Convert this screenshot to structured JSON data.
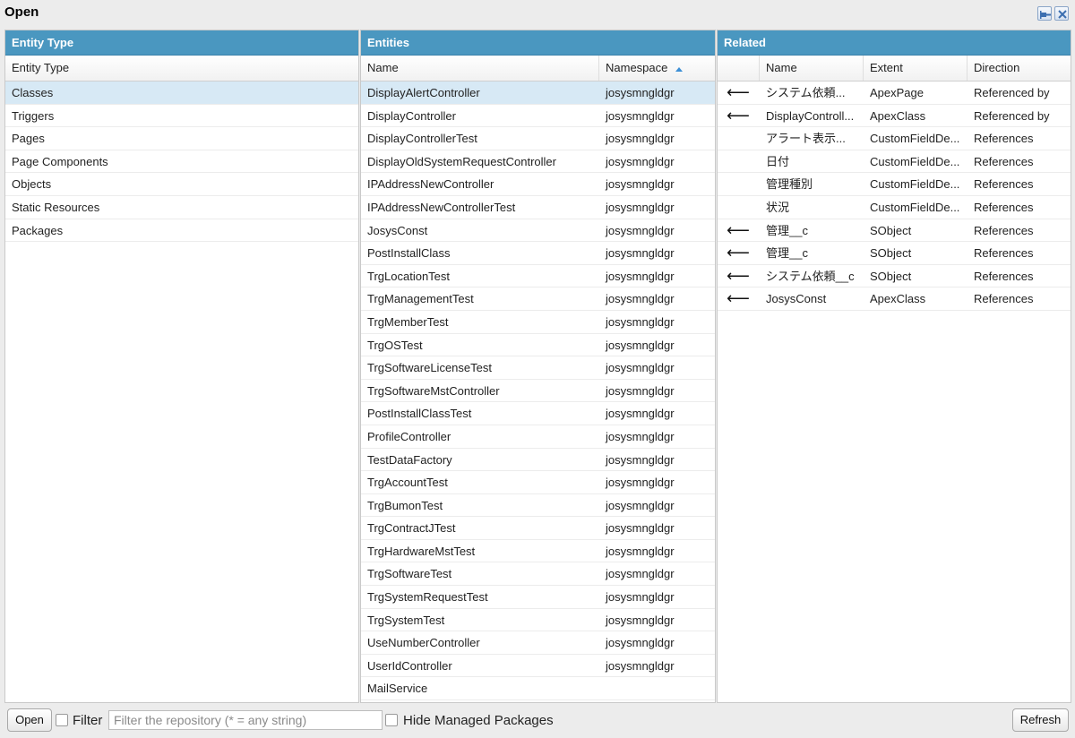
{
  "window": {
    "title": "Open"
  },
  "entity_type_panel": {
    "header": "Entity Type",
    "column": "Entity Type",
    "items": [
      "Classes",
      "Triggers",
      "Pages",
      "Page Components",
      "Objects",
      "Static Resources",
      "Packages"
    ],
    "selected_index": 0
  },
  "entities_panel": {
    "header": "Entities",
    "columns": {
      "name": "Name",
      "namespace": "Namespace"
    },
    "sort": {
      "column": "Namespace",
      "direction": "ascending"
    },
    "rows": [
      {
        "name": "DisplayAlertController",
        "namespace": "josysmngldgr"
      },
      {
        "name": "DisplayController",
        "namespace": "josysmngldgr"
      },
      {
        "name": "DisplayControllerTest",
        "namespace": "josysmngldgr"
      },
      {
        "name": "DisplayOldSystemRequestController",
        "namespace": "josysmngldgr"
      },
      {
        "name": "IPAddressNewController",
        "namespace": "josysmngldgr"
      },
      {
        "name": "IPAddressNewControllerTest",
        "namespace": "josysmngldgr"
      },
      {
        "name": "JosysConst",
        "namespace": "josysmngldgr"
      },
      {
        "name": "PostInstallClass",
        "namespace": "josysmngldgr"
      },
      {
        "name": "TrgLocationTest",
        "namespace": "josysmngldgr"
      },
      {
        "name": "TrgManagementTest",
        "namespace": "josysmngldgr"
      },
      {
        "name": "TrgMemberTest",
        "namespace": "josysmngldgr"
      },
      {
        "name": "TrgOSTest",
        "namespace": "josysmngldgr"
      },
      {
        "name": "TrgSoftwareLicenseTest",
        "namespace": "josysmngldgr"
      },
      {
        "name": "TrgSoftwareMstController",
        "namespace": "josysmngldgr"
      },
      {
        "name": "PostInstallClassTest",
        "namespace": "josysmngldgr"
      },
      {
        "name": "ProfileController",
        "namespace": "josysmngldgr"
      },
      {
        "name": "TestDataFactory",
        "namespace": "josysmngldgr"
      },
      {
        "name": "TrgAccountTest",
        "namespace": "josysmngldgr"
      },
      {
        "name": "TrgBumonTest",
        "namespace": "josysmngldgr"
      },
      {
        "name": "TrgContractJTest",
        "namespace": "josysmngldgr"
      },
      {
        "name": "TrgHardwareMstTest",
        "namespace": "josysmngldgr"
      },
      {
        "name": "TrgSoftwareTest",
        "namespace": "josysmngldgr"
      },
      {
        "name": "TrgSystemRequestTest",
        "namespace": "josysmngldgr"
      },
      {
        "name": "TrgSystemTest",
        "namespace": "josysmngldgr"
      },
      {
        "name": "UseNumberController",
        "namespace": "josysmngldgr"
      },
      {
        "name": "UserIdController",
        "namespace": "josysmngldgr"
      },
      {
        "name": "MailService",
        "namespace": ""
      }
    ],
    "selected_index": 0
  },
  "related_panel": {
    "header": "Related",
    "columns": {
      "name": "Name",
      "extent": "Extent",
      "direction": "Direction"
    },
    "rows": [
      {
        "arrow": true,
        "name": "システム依頼...",
        "extent": "ApexPage",
        "direction": "Referenced by"
      },
      {
        "arrow": true,
        "name": "DisplayControll...",
        "extent": "ApexClass",
        "direction": "Referenced by"
      },
      {
        "arrow": false,
        "name": "アラート表示...",
        "extent": "CustomFieldDe...",
        "direction": "References"
      },
      {
        "arrow": false,
        "name": "日付",
        "extent": "CustomFieldDe...",
        "direction": "References"
      },
      {
        "arrow": false,
        "name": "管理種別",
        "extent": "CustomFieldDe...",
        "direction": "References"
      },
      {
        "arrow": false,
        "name": "状況",
        "extent": "CustomFieldDe...",
        "direction": "References"
      },
      {
        "arrow": true,
        "name": "管理__c",
        "extent": "SObject",
        "direction": "References"
      },
      {
        "arrow": true,
        "name": "管理__c",
        "extent": "SObject",
        "direction": "References"
      },
      {
        "arrow": true,
        "name": "システム依頼__c",
        "extent": "SObject",
        "direction": "References"
      },
      {
        "arrow": true,
        "name": "JosysConst",
        "extent": "ApexClass",
        "direction": "References"
      }
    ]
  },
  "footer": {
    "open_label": "Open",
    "filter_label": "Filter",
    "filter_placeholder": "Filter the repository (* = any string)",
    "filter_value": "",
    "filter_checked": false,
    "hide_managed_label": "Hide Managed Packages",
    "hide_managed_checked": false,
    "refresh_label": "Refresh"
  },
  "icons": {
    "arrow": "left-arrow-icon",
    "pin": "pin-icon",
    "close": "close-icon",
    "sort": "sort-ascending-icon"
  },
  "colors": {
    "header_blue": "#4a97c0",
    "selected_row": "#d7e9f5",
    "sort_arrow": "#3c8fd6"
  }
}
